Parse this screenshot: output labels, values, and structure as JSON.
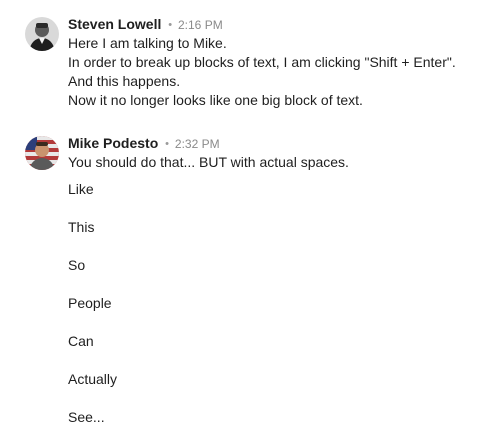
{
  "messages": [
    {
      "author": "Steven Lowell",
      "separator": "•",
      "time": "2:16 PM",
      "avatar_icon": "steven-avatar",
      "lines": [
        "Here I am talking to Mike.",
        "In order to break up blocks of text, I am clicking \"Shift + Enter\".",
        "And this happens.",
        "Now it no longer looks like one big block of text."
      ]
    },
    {
      "author": "Mike Podesto",
      "separator": "•",
      "time": "2:32 PM",
      "avatar_icon": "mike-avatar",
      "lines": [
        "You should do that... BUT with actual spaces.",
        "Like",
        "This",
        "So",
        "People",
        "Can",
        "Actually",
        "See..."
      ]
    }
  ]
}
